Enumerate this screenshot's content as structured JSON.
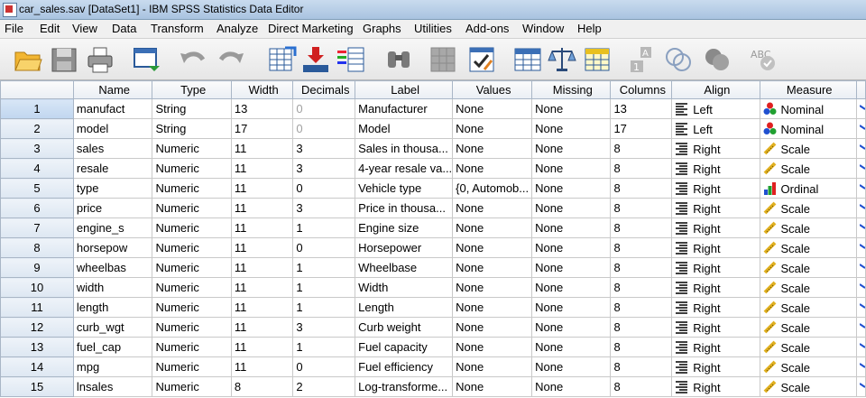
{
  "window": {
    "title": "car_sales.sav [DataSet1] - IBM SPSS Statistics Data Editor"
  },
  "menu": [
    "File",
    "Edit",
    "View",
    "Data",
    "Transform",
    "Analyze",
    "Direct Marketing",
    "Graphs",
    "Utilities",
    "Add-ons",
    "Window",
    "Help"
  ],
  "toolbar": [
    "open-icon",
    "save-icon",
    "print-icon",
    "recall-dialog-icon",
    "undo-icon",
    "redo-icon",
    "goto-case-icon",
    "goto-variable-icon",
    "variables-icon",
    "find-icon",
    "split-file-icon",
    "select-cases-icon",
    "value-labels-icon",
    "weight-cases-icon",
    "insert-cases-icon",
    "use-sets-icon",
    "show-all-variables-icon",
    "spell-check-icon"
  ],
  "columns": [
    "",
    "Name",
    "Type",
    "Width",
    "Decimals",
    "Label",
    "Values",
    "Missing",
    "Columns",
    "Align",
    "Measure"
  ],
  "rows": [
    [
      "1",
      "manufact",
      "String",
      "13",
      "0",
      "Manufacturer",
      "None",
      "None",
      "13",
      "Left",
      "Nominal"
    ],
    [
      "2",
      "model",
      "String",
      "17",
      "0",
      "Model",
      "None",
      "None",
      "17",
      "Left",
      "Nominal"
    ],
    [
      "3",
      "sales",
      "Numeric",
      "11",
      "3",
      "Sales in thousa...",
      "None",
      "None",
      "8",
      "Right",
      "Scale"
    ],
    [
      "4",
      "resale",
      "Numeric",
      "11",
      "3",
      "4-year resale va...",
      "None",
      "None",
      "8",
      "Right",
      "Scale"
    ],
    [
      "5",
      "type",
      "Numeric",
      "11",
      "0",
      "Vehicle type",
      "{0, Automob...",
      "None",
      "8",
      "Right",
      "Ordinal"
    ],
    [
      "6",
      "price",
      "Numeric",
      "11",
      "3",
      "Price in thousa...",
      "None",
      "None",
      "8",
      "Right",
      "Scale"
    ],
    [
      "7",
      "engine_s",
      "Numeric",
      "11",
      "1",
      "Engine size",
      "None",
      "None",
      "8",
      "Right",
      "Scale"
    ],
    [
      "8",
      "horsepow",
      "Numeric",
      "11",
      "0",
      "Horsepower",
      "None",
      "None",
      "8",
      "Right",
      "Scale"
    ],
    [
      "9",
      "wheelbas",
      "Numeric",
      "11",
      "1",
      "Wheelbase",
      "None",
      "None",
      "8",
      "Right",
      "Scale"
    ],
    [
      "10",
      "width",
      "Numeric",
      "11",
      "1",
      "Width",
      "None",
      "None",
      "8",
      "Right",
      "Scale"
    ],
    [
      "11",
      "length",
      "Numeric",
      "11",
      "1",
      "Length",
      "None",
      "None",
      "8",
      "Right",
      "Scale"
    ],
    [
      "12",
      "curb_wgt",
      "Numeric",
      "11",
      "3",
      "Curb weight",
      "None",
      "None",
      "8",
      "Right",
      "Scale"
    ],
    [
      "13",
      "fuel_cap",
      "Numeric",
      "11",
      "1",
      "Fuel capacity",
      "None",
      "None",
      "8",
      "Right",
      "Scale"
    ],
    [
      "14",
      "mpg",
      "Numeric",
      "11",
      "0",
      "Fuel efficiency",
      "None",
      "None",
      "8",
      "Right",
      "Scale"
    ],
    [
      "15",
      "lnsales",
      "Numeric",
      "8",
      "2",
      "Log-transforme...",
      "None",
      "None",
      "8",
      "Right",
      "Scale"
    ]
  ]
}
